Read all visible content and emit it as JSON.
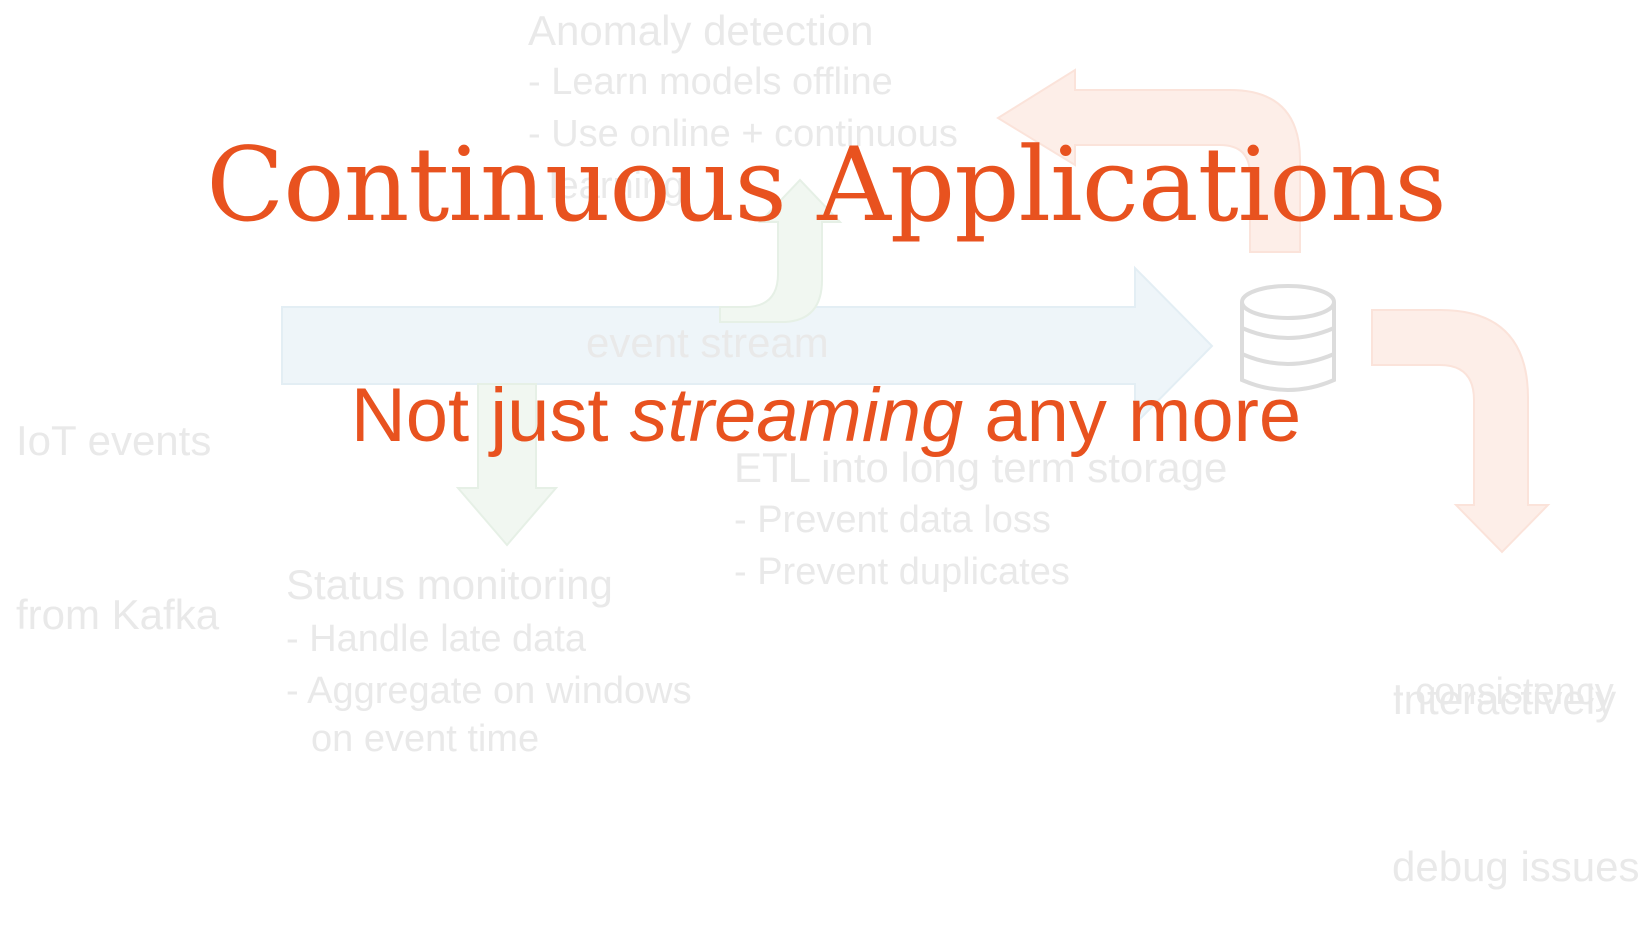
{
  "title": "Continuous Applications",
  "subtitle": {
    "before": "Not just ",
    "emphasis": "streaming",
    "after": " any more"
  },
  "diagram": {
    "anomaly": {
      "title": "Anomaly detection",
      "lines": [
        "- Learn models offline",
        "- Use online + continuous",
        "  learning"
      ]
    },
    "source": [
      "IoT events",
      "from Kafka"
    ],
    "stream_label": "event stream",
    "etl": {
      "title": "ETL into long term storage",
      "lines": [
        "- Prevent data loss",
        "- Prevent duplicates"
      ]
    },
    "status": {
      "title": "Status monitoring",
      "lines": [
        "- Handle late data",
        "- Aggregate on windows",
        "on event time"
      ]
    },
    "interactive": {
      "title": [
        "Interactively",
        "debug issues"
      ],
      "lines": [
        "- consistency"
      ]
    },
    "icons": [
      "database-icon"
    ],
    "colors": {
      "accent": "#e8521f",
      "faint_text": "#e9e9e9",
      "blue_arrow": "#eef5f9",
      "green_arrow": "#f1f7f1",
      "orange_arrow": "#fdeee8"
    }
  }
}
